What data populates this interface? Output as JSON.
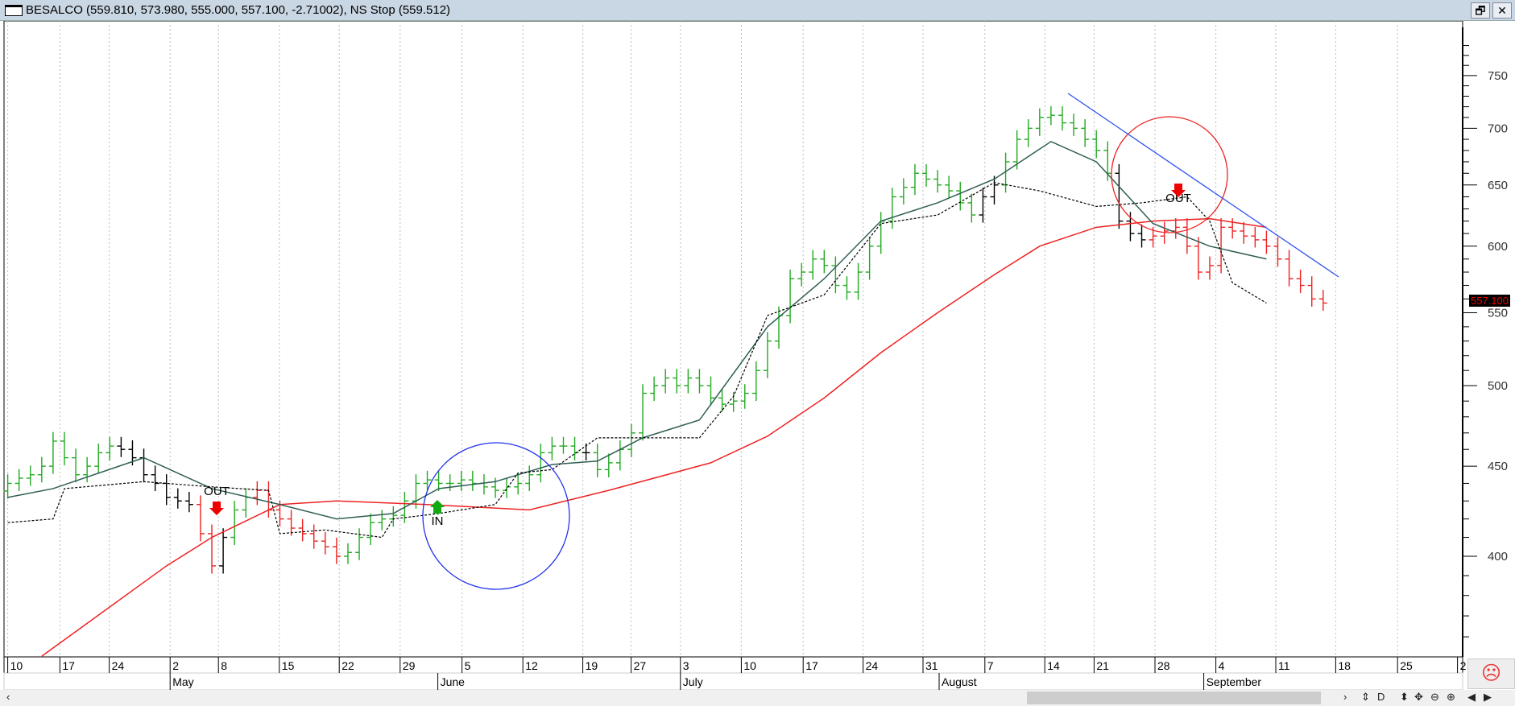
{
  "window": {
    "title": "BESALCO (559.810, 573.980, 555.000, 557.100, -2.71002), NS Stop (559.512)",
    "restore": "🗗",
    "close": "✕"
  },
  "last_price": "557.100",
  "status_icon": "sad-face",
  "toolbar": {
    "scroll_left": "‹",
    "scroll_right": "›",
    "buttons": [
      "⇕",
      "D",
      "⬍",
      "✥",
      "⊖",
      "⊕",
      "◀",
      "▶"
    ]
  },
  "annotations": {
    "out1": "OUT",
    "in1": "IN",
    "out2": "OUT"
  },
  "colors": {
    "up": "#22aa22",
    "down": "#ee2222",
    "neutral": "#000000",
    "ma_slow": "#ee2222",
    "ma_fast": "#2f5f55",
    "stop": "#000000",
    "circle1": "#2233ee",
    "circle2": "#ee2222",
    "trend": "#3355ee"
  },
  "chart_data": {
    "type": "ohlc",
    "title": "BESALCO",
    "ylim": [
      350,
      790
    ],
    "yscale": "log",
    "yticks": [
      400,
      450,
      500,
      550,
      600,
      650,
      700,
      750
    ],
    "xticks": [
      "10",
      "17",
      "24",
      "2",
      "8",
      "15",
      "22",
      "29",
      "5",
      "12",
      "19",
      "27",
      "3",
      "10",
      "17",
      "24",
      "31",
      "7",
      "14",
      "21",
      "28",
      "4",
      "11",
      "18",
      "25",
      "2"
    ],
    "months": [
      {
        "label": "May",
        "tick": 3
      },
      {
        "label": "June",
        "tick": 8
      },
      {
        "label": "July",
        "tick": 12
      },
      {
        "label": "August",
        "tick": 16
      },
      {
        "label": "September",
        "tick": 21
      }
    ],
    "closes": [
      440,
      443,
      445,
      450,
      465,
      455,
      445,
      450,
      458,
      462,
      460,
      455,
      445,
      440,
      432,
      430,
      428,
      412,
      395,
      410,
      425,
      432,
      436,
      425,
      420,
      415,
      412,
      408,
      405,
      400,
      402,
      410,
      418,
      420,
      422,
      430,
      440,
      442,
      440,
      440,
      442,
      440,
      438,
      436,
      438,
      440,
      445,
      458,
      462,
      462,
      458,
      458,
      448,
      452,
      460,
      470,
      495,
      500,
      505,
      500,
      505,
      500,
      492,
      488,
      490,
      495,
      510,
      530,
      548,
      575,
      580,
      590,
      585,
      570,
      565,
      580,
      600,
      620,
      640,
      648,
      660,
      655,
      650,
      645,
      635,
      625,
      640,
      650,
      670,
      690,
      700,
      710,
      712,
      705,
      700,
      690,
      680,
      660,
      620,
      610,
      605,
      608,
      612,
      615,
      600,
      580,
      585,
      615,
      612,
      608,
      605,
      600,
      590,
      575,
      570,
      560,
      557
    ],
    "colors": "ggggggggggkkkkkkkrrkggrrrrrrrrgggggggggggggggggggggkggggggggggggggggggggggggggggggggggkkggggggggggkkkrrrrrrrrrrrrrrrrrrrrrr",
    "ma_slow": [
      [
        3,
        351
      ],
      [
        14,
        395
      ],
      [
        18,
        410
      ],
      [
        24,
        428
      ],
      [
        29,
        430
      ],
      [
        37,
        428
      ],
      [
        46,
        425
      ],
      [
        53,
        436
      ],
      [
        62,
        452
      ],
      [
        67,
        468
      ],
      [
        72,
        492
      ],
      [
        77,
        522
      ],
      [
        82,
        550
      ],
      [
        87,
        578
      ],
      [
        91,
        600
      ],
      [
        96,
        615
      ],
      [
        101,
        620
      ],
      [
        106,
        622
      ],
      [
        111,
        615
      ]
    ],
    "ma_fast": [
      [
        0,
        432
      ],
      [
        4,
        437
      ],
      [
        12,
        455
      ],
      [
        18,
        437
      ],
      [
        24,
        428
      ],
      [
        29,
        420
      ],
      [
        34,
        423
      ],
      [
        38,
        437
      ],
      [
        43,
        441
      ],
      [
        48,
        451
      ],
      [
        52,
        453
      ],
      [
        56,
        467
      ],
      [
        61,
        478
      ],
      [
        67,
        540
      ],
      [
        72,
        575
      ],
      [
        77,
        620
      ],
      [
        82,
        635
      ],
      [
        87,
        655
      ],
      [
        92,
        688
      ],
      [
        96,
        670
      ],
      [
        101,
        618
      ],
      [
        106,
        600
      ],
      [
        111,
        590
      ]
    ],
    "ns_stop": [
      [
        0,
        418
      ],
      [
        4,
        420
      ],
      [
        5,
        437
      ],
      [
        12,
        441
      ],
      [
        18,
        438
      ],
      [
        23,
        436
      ],
      [
        24,
        412
      ],
      [
        28,
        414
      ],
      [
        33,
        410
      ],
      [
        34,
        420
      ],
      [
        38,
        423
      ],
      [
        43,
        428
      ],
      [
        45,
        446
      ],
      [
        48,
        448
      ],
      [
        52,
        467
      ],
      [
        56,
        467
      ],
      [
        61,
        467
      ],
      [
        64,
        493
      ],
      [
        67,
        548
      ],
      [
        72,
        563
      ],
      [
        77,
        618
      ],
      [
        82,
        625
      ],
      [
        87,
        652
      ],
      [
        91,
        645
      ],
      [
        96,
        632
      ],
      [
        100,
        635
      ],
      [
        104,
        640
      ],
      [
        106,
        620
      ],
      [
        108,
        572
      ],
      [
        111,
        557
      ]
    ]
  }
}
